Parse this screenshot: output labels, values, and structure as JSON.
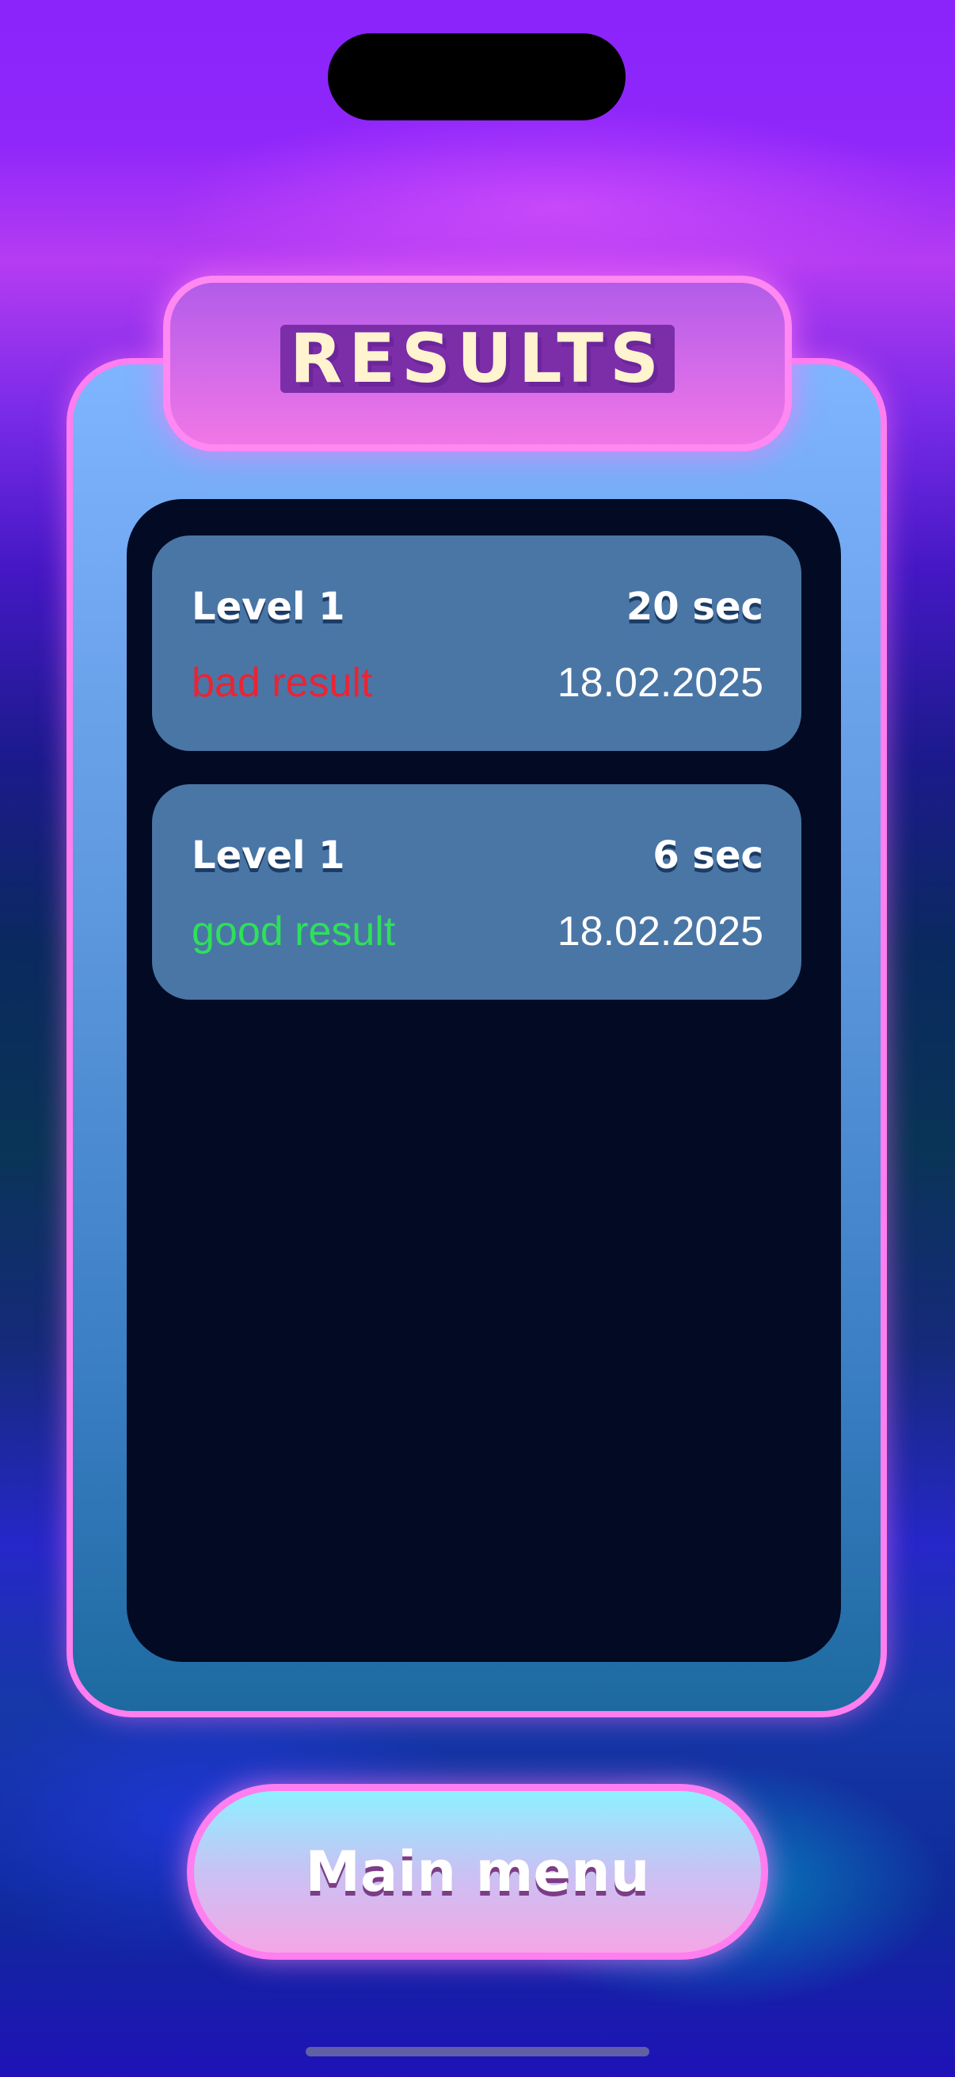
{
  "title": "RESULTS",
  "results": [
    {
      "level": "Level 1",
      "time": "20 sec",
      "verdict": "bad result",
      "date": "18.02.2025"
    },
    {
      "level": "Level 1",
      "time": "6 sec",
      "verdict": "good result",
      "date": "18.02.2025"
    }
  ],
  "button": {
    "label": "Main menu"
  },
  "colors": {
    "accent_pink": "#ff7ef0",
    "bad": "#ea2433",
    "good": "#2ee05a",
    "row_bg": "#4a76a6",
    "list_bg": "#020a24"
  }
}
